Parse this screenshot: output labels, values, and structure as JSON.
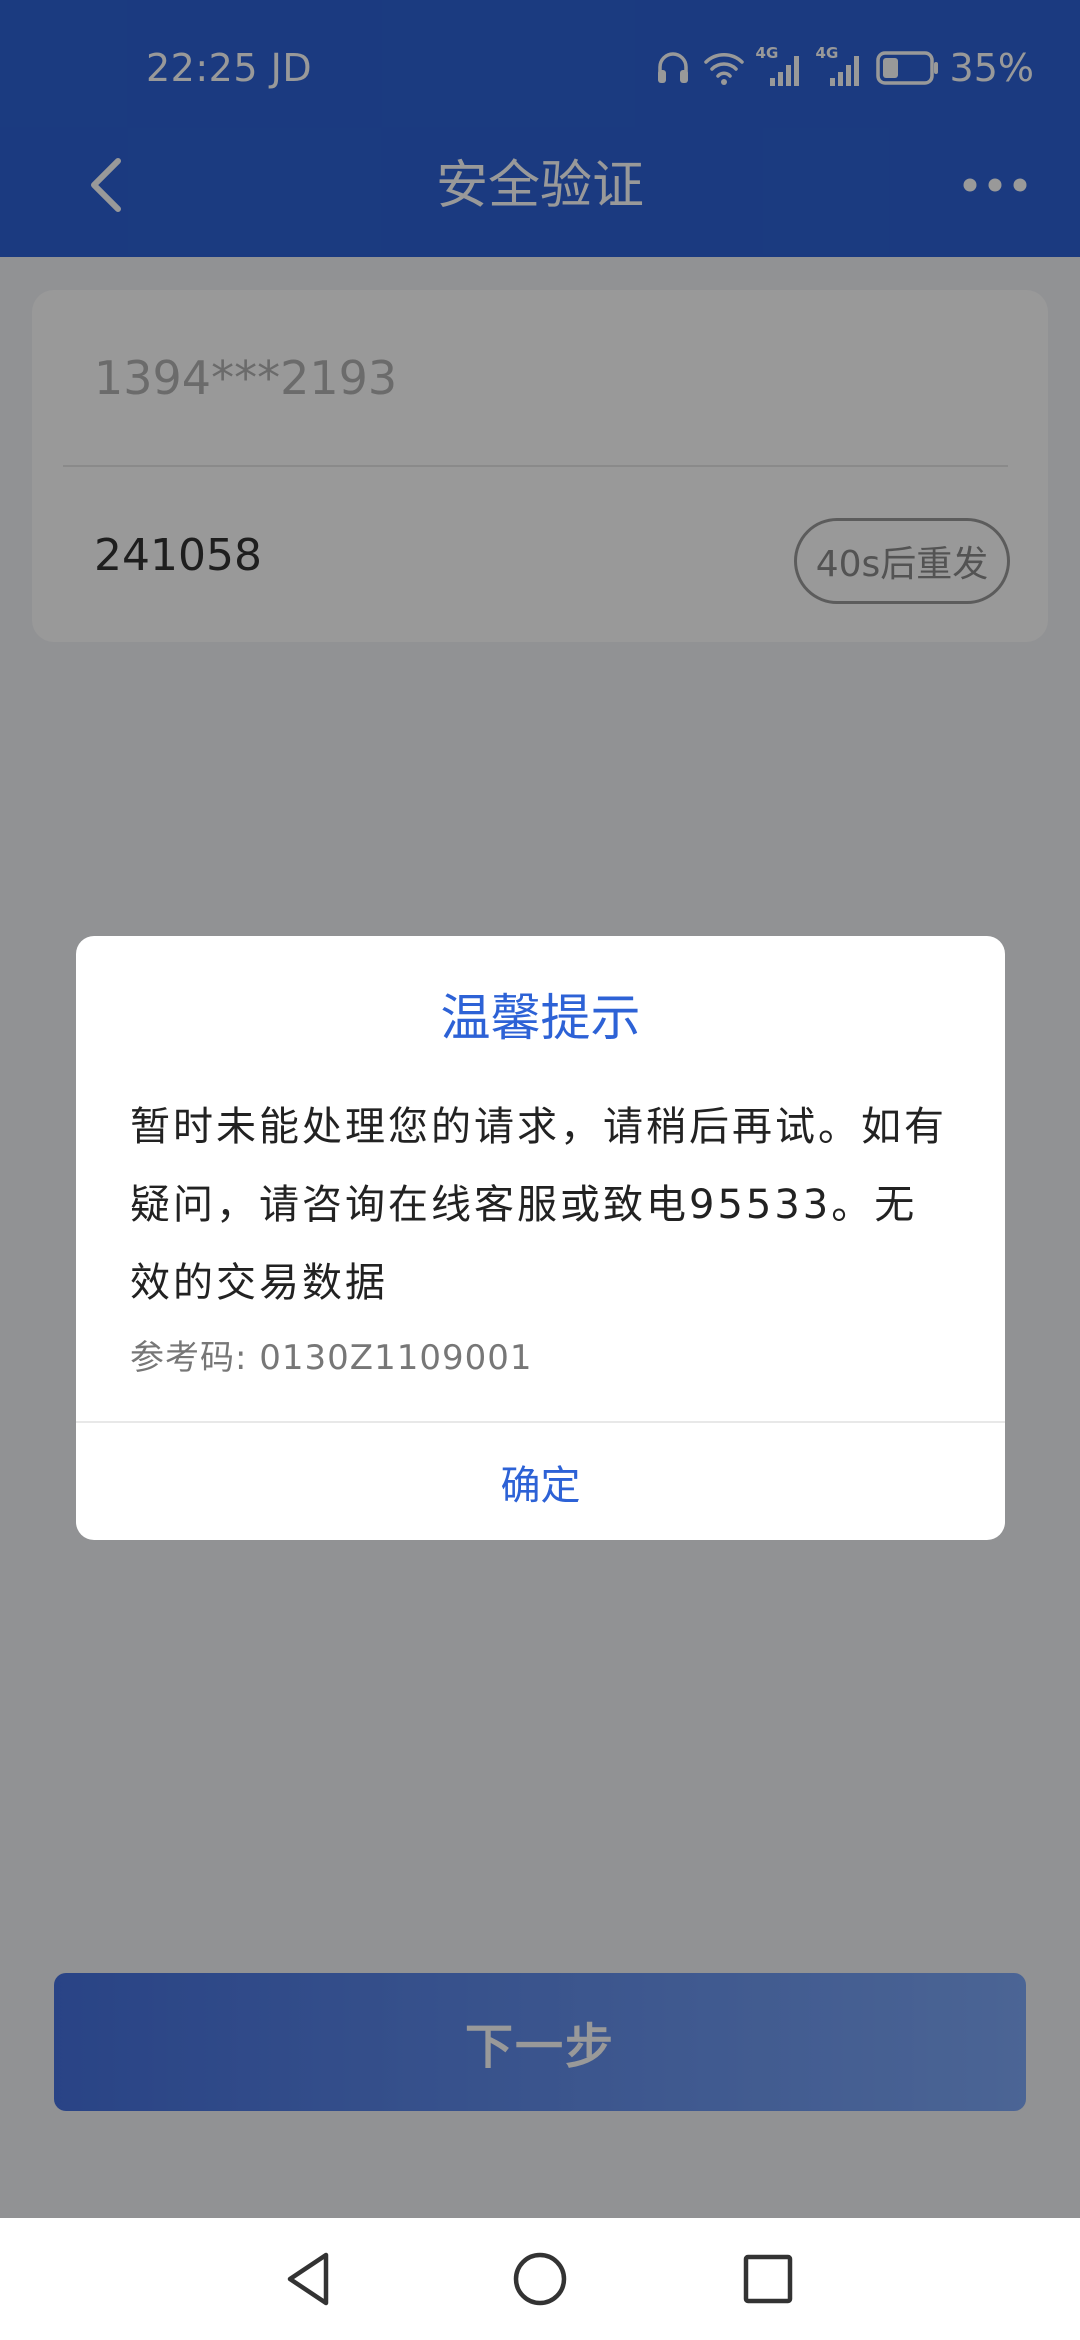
{
  "status_bar": {
    "time": "22:25",
    "carrier_tag": "JD",
    "network_1": "4G",
    "network_2": "4G",
    "battery_percent": "35%",
    "battery_level": 0.35,
    "icons": [
      "headphones-icon",
      "wifi-icon",
      "signal-icon",
      "signal-icon",
      "battery-icon"
    ]
  },
  "header": {
    "title": "安全验证",
    "back_icon": "chevron-left-icon",
    "more_icon": "more-dots-icon"
  },
  "form": {
    "phone_value": "1394***2193",
    "code_value": "241058",
    "resend_label": "40s后重发"
  },
  "next_button_label": "下一步",
  "dialog": {
    "title": "温馨提示",
    "message": "暂时未能处理您的请求，请稍后再试。如有疑问，请咨询在线客服或致电95533。无效的交易数据",
    "ref_label": "参考码:",
    "ref_code": "0130Z1109001",
    "confirm_label": "确定"
  },
  "nav_bar": {
    "icons": [
      "back-triangle-icon",
      "home-circle-icon",
      "recent-square-icon"
    ]
  },
  "colors": {
    "brand_blue": "#2d62d6",
    "dialog_title": "#2d62d6",
    "overlay": "rgba(0,0,0,0.40)"
  }
}
